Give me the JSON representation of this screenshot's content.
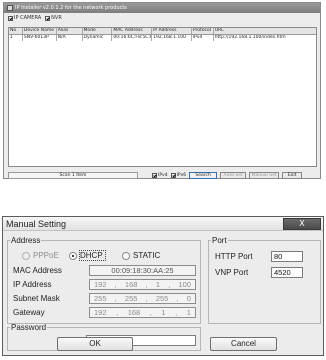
{
  "installer": {
    "title": "IP Installer v2.0.1.2 for the network products",
    "options": {
      "ip_camera": "IP CAMERA",
      "nvr": "NVR"
    },
    "columns": [
      "No",
      "Device Name",
      "Alias",
      "Mode",
      "MAC Address",
      "IP Address",
      "Protocol",
      "URL"
    ],
    "rows": [
      [
        "1",
        "SNV-6013P",
        "N/A",
        "Dynamic",
        "00:16:6C:F8:5C:F7",
        "192.168.1.100",
        "IPv4",
        "http://192.168.1.100/index.htm"
      ]
    ],
    "status": "Scan 1 Item",
    "ipv4": "IPv4",
    "ipv6": "IPv6",
    "buttons": {
      "search": "Search",
      "auto_set": "Auto Set",
      "manual_set": "Manual Set",
      "exit": "Exit"
    }
  },
  "manual": {
    "title": "Manual Setting",
    "close": "X",
    "address_group": "Address",
    "pppoe": "PPPoE",
    "dhcp": "DHCP",
    "static": "STATIC",
    "mac_label": "MAC Address",
    "mac_value": "00:09:18:30:AA:25",
    "ip_label": "IP Address",
    "ip": [
      "192",
      "168",
      "1",
      "100"
    ],
    "subnet_label": "Subnet Mask",
    "subnet": [
      "255",
      "255",
      "255",
      "0"
    ],
    "gateway_label": "Gateway",
    "gateway": [
      "192",
      "168",
      "1",
      "1"
    ],
    "port_group": "Port",
    "http_label": "HTTP Port",
    "http_value": "80",
    "vnp_label": "VNP Port",
    "vnp_value": "4520",
    "password_group": "Password",
    "password_value": "",
    "ok": "OK",
    "cancel": "Cancel"
  }
}
